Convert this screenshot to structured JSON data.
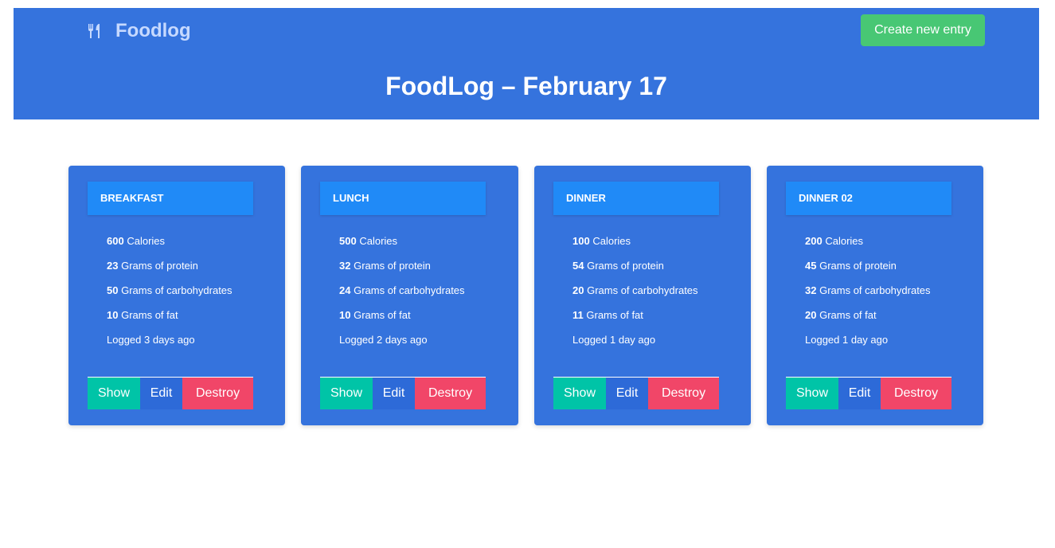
{
  "app": {
    "brand": "Foodlog",
    "brand_icon": "fork-knife-icon",
    "create_button": "Create new entry",
    "page_title": "FoodLog – February 17"
  },
  "colors": {
    "primary": "#3573dd",
    "header_card": "#208af7",
    "success": "#48c774",
    "show": "#00c4a7",
    "destroy": "#f14668"
  },
  "meals": [
    {
      "title": "BREAKFAST",
      "calories": "600",
      "calories_label": "Calories",
      "protein": "23",
      "protein_label": "Grams of protein",
      "carbs": "50",
      "carbs_label": "Grams of carbohydrates",
      "fat": "10",
      "fat_label": "Grams of fat",
      "logged": "Logged 3 days ago",
      "show": "Show",
      "edit": "Edit",
      "destroy": "Destroy"
    },
    {
      "title": "LUNCH",
      "calories": "500",
      "calories_label": "Calories",
      "protein": "32",
      "protein_label": "Grams of protein",
      "carbs": "24",
      "carbs_label": "Grams of carbohydrates",
      "fat": "10",
      "fat_label": "Grams of fat",
      "logged": "Logged 2 days ago",
      "show": "Show",
      "edit": "Edit",
      "destroy": "Destroy"
    },
    {
      "title": "DINNER",
      "calories": "100",
      "calories_label": "Calories",
      "protein": "54",
      "protein_label": "Grams of protein",
      "carbs": "20",
      "carbs_label": "Grams of carbohydrates",
      "fat": "11",
      "fat_label": "Grams of fat",
      "logged": "Logged 1 day ago",
      "show": "Show",
      "edit": "Edit",
      "destroy": "Destroy"
    },
    {
      "title": "DINNER 02",
      "calories": "200",
      "calories_label": "Calories",
      "protein": "45",
      "protein_label": "Grams of protein",
      "carbs": "32",
      "carbs_label": "Grams of carbohydrates",
      "fat": "20",
      "fat_label": "Grams of fat",
      "logged": "Logged 1 day ago",
      "show": "Show",
      "edit": "Edit",
      "destroy": "Destroy"
    }
  ]
}
